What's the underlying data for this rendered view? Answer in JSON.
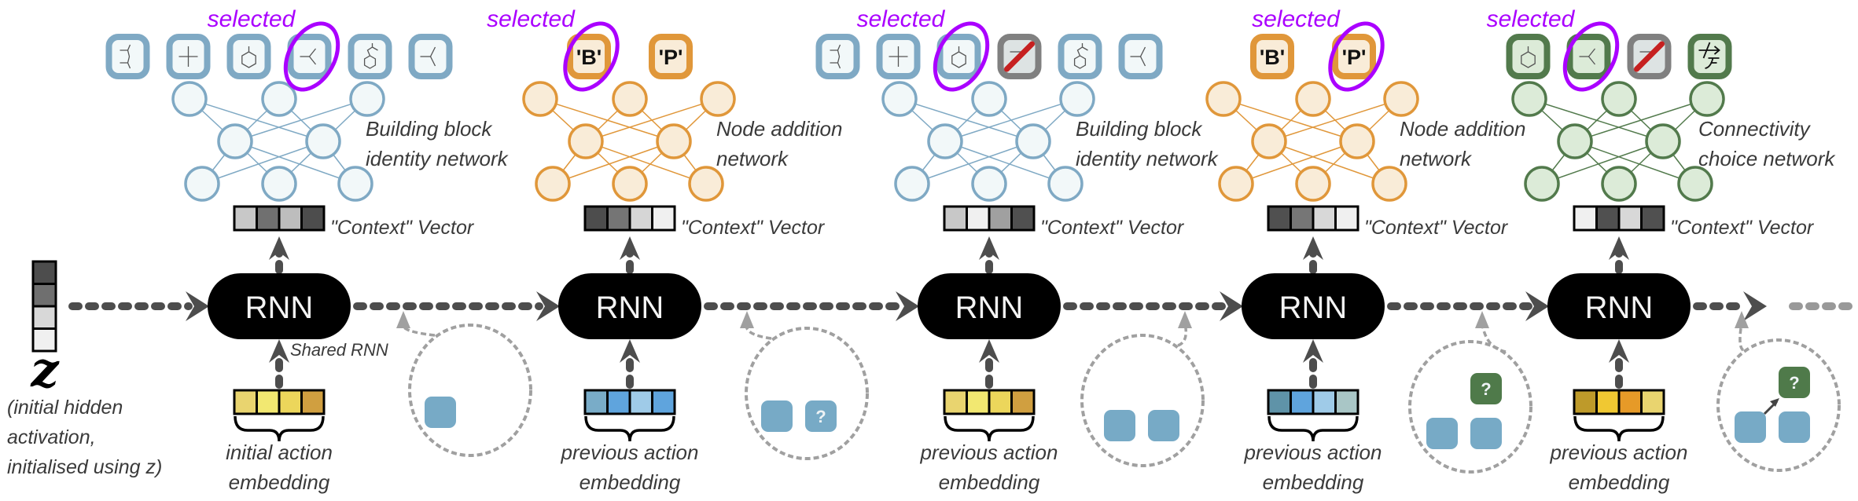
{
  "rnn_label": "RNN",
  "shared_rnn_label": "Shared RNN",
  "selected_label": "selected",
  "context_label": "\"Context\" Vector",
  "initial_state": {
    "symbol": "z",
    "vector_shades": [
      "#4d4d4d",
      "#6f6f6f",
      "#d8d8d8",
      "#f0f0f0"
    ],
    "label_lines": [
      "(initial hidden",
      "activation,",
      "initialised using z)"
    ]
  },
  "palette": {
    "building-block": {
      "stroke": "#7fa9c4",
      "fill": "#f2f8f9"
    },
    "node-addition": {
      "stroke": "#e0973a",
      "fill": "#f9ecd8"
    },
    "connectivity": {
      "stroke": "#527a4c",
      "fill": "#dcebd8"
    },
    "disabled": {
      "stroke": "#808080",
      "fill": "#dde3e3"
    },
    "selection": "#aa00ff",
    "graph_node": "#77aac6",
    "pending_node": "#4f7a4a",
    "flow": "#4d4d4d"
  },
  "steps": [
    {
      "network_type": "building-block",
      "network_label": [
        "Building block",
        "identity network"
      ],
      "context_shades": [
        "#c8c8c8",
        "#707070",
        "#bdbdbd",
        "#4d4d4d"
      ],
      "embedding_colors": [
        "#e9d46f",
        "#f2e871",
        "#ecd65b",
        "#d09f40"
      ],
      "embedding_label": [
        "initial action",
        "embedding"
      ],
      "options": [
        {
          "icon": "anhydride-molecule-icon",
          "selected": false
        },
        {
          "icon": "ammonium-molecule-icon",
          "selected": false
        },
        {
          "icon": "benzene-molecule-icon",
          "selected": false
        },
        {
          "icon": "nitro-molecule-icon",
          "selected": true
        },
        {
          "icon": "isobutylbenzene-molecule-icon",
          "selected": false
        },
        {
          "icon": "acetyl-molecule-icon",
          "selected": false
        }
      ],
      "graph_state": {
        "nodes": 1,
        "pending": "none",
        "pending_label": ""
      }
    },
    {
      "network_type": "node-addition",
      "network_label": [
        "Node addition",
        "network"
      ],
      "context_shades": [
        "#4d4d4d",
        "#757575",
        "#d6d6d6",
        "#f0f0f0"
      ],
      "embedding_colors": [
        "#79acc8",
        "#5fa4dd",
        "#9fcbe8",
        "#5fa4dd"
      ],
      "embedding_label": [
        "previous action",
        "embedding"
      ],
      "options": [
        {
          "label": "'B'",
          "selected": true
        },
        {
          "label": "'P'",
          "selected": false
        }
      ],
      "graph_state": {
        "nodes": 1,
        "pending": "node",
        "pending_label": "?"
      }
    },
    {
      "network_type": "building-block",
      "network_label": [
        "Building block",
        "identity network"
      ],
      "context_shades": [
        "#c8c8c8",
        "#f0f0f0",
        "#a0a0a0",
        "#505050"
      ],
      "embedding_colors": [
        "#e9d46f",
        "#f2e871",
        "#ecd65b",
        "#d09f40"
      ],
      "embedding_label": [
        "previous action",
        "embedding"
      ],
      "options": [
        {
          "icon": "anhydride-molecule-icon",
          "selected": false
        },
        {
          "icon": "ammonium-molecule-icon",
          "selected": false
        },
        {
          "icon": "benzene-molecule-icon",
          "selected": true
        },
        {
          "icon": "masked-option-icon",
          "selected": false,
          "disabled": true
        },
        {
          "icon": "isobutylbenzene-molecule-icon",
          "selected": false
        },
        {
          "icon": "acetyl-molecule-icon",
          "selected": false
        }
      ],
      "graph_state": {
        "nodes": 2,
        "pending": "none",
        "pending_label": ""
      }
    },
    {
      "network_type": "node-addition",
      "network_label": [
        "Node addition",
        "network"
      ],
      "context_shades": [
        "#505050",
        "#767676",
        "#d8d8d8",
        "#f0f0f0"
      ],
      "embedding_colors": [
        "#5f93a8",
        "#5fa4dd",
        "#9fcbe8",
        "#a9c6c6"
      ],
      "embedding_label": [
        "previous action",
        "embedding"
      ],
      "options": [
        {
          "label": "'B'",
          "selected": false
        },
        {
          "label": "'P'",
          "selected": true
        }
      ],
      "graph_state": {
        "nodes": 2,
        "pending": "product",
        "pending_label": "?"
      }
    },
    {
      "network_type": "connectivity",
      "network_label": [
        "Connectivity",
        "choice network"
      ],
      "context_shades": [
        "#f0f0f0",
        "#505050",
        "#d8d8d8",
        "#505050"
      ],
      "embedding_colors": [
        "#be9a2a",
        "#f0c832",
        "#e69a28",
        "#e9d46f"
      ],
      "embedding_label": [
        "previous action",
        "embedding"
      ],
      "options": [
        {
          "icon": "benzene-molecule-icon",
          "selected": false
        },
        {
          "icon": "nitro-molecule-icon",
          "selected": true
        },
        {
          "icon": "masked-option-icon",
          "selected": false,
          "disabled": true
        },
        {
          "icon": "stop-icon",
          "selected": false
        }
      ],
      "graph_state": {
        "nodes": 2,
        "pending": "product-connected",
        "pending_label": "?"
      }
    }
  ]
}
